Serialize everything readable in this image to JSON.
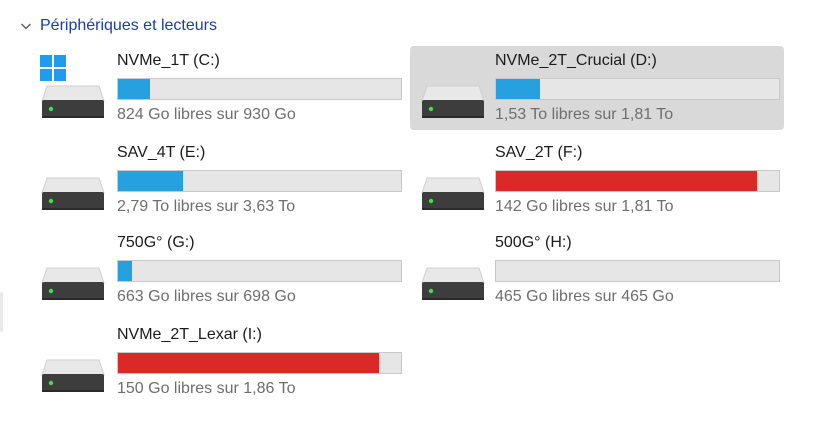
{
  "section": {
    "title": "Périphériques et lecteurs",
    "icon": "chevron-down-icon"
  },
  "colors": {
    "used_normal": "#27a0e0",
    "used_critical": "#da2a28",
    "section_title": "#1a3fa0",
    "selected_background": "#d9d9d9"
  },
  "drives": [
    {
      "name": "NVMe_1T (C:)",
      "caption": "824 Go libres sur 930 Go",
      "used_fraction": 0.114,
      "status": "normal",
      "selected": false,
      "system_drive": true
    },
    {
      "name": "NVMe_2T_Crucial (D:)",
      "caption": "1,53 To libres sur 1,81 To",
      "used_fraction": 0.155,
      "status": "normal",
      "selected": true,
      "system_drive": false
    },
    {
      "name": "SAV_4T (E:)",
      "caption": "2,79 To libres sur 3,63 To",
      "used_fraction": 0.231,
      "status": "normal",
      "selected": false,
      "system_drive": false
    },
    {
      "name": "SAV_2T (F:)",
      "caption": "142 Go libres sur 1,81 To",
      "used_fraction": 0.923,
      "status": "critical",
      "selected": false,
      "system_drive": false
    },
    {
      "name": "750G° (G:)",
      "caption": "663 Go libres sur 698 Go",
      "used_fraction": 0.05,
      "status": "normal",
      "selected": false,
      "system_drive": false
    },
    {
      "name": "500G° (H:)",
      "caption": "465 Go libres sur 465 Go",
      "used_fraction": 0.0,
      "status": "normal",
      "selected": false,
      "system_drive": false
    },
    {
      "name": "NVMe_2T_Lexar (I:)",
      "caption": "150 Go libres sur 1,86 To",
      "used_fraction": 0.921,
      "status": "critical",
      "selected": false,
      "system_drive": false
    }
  ]
}
